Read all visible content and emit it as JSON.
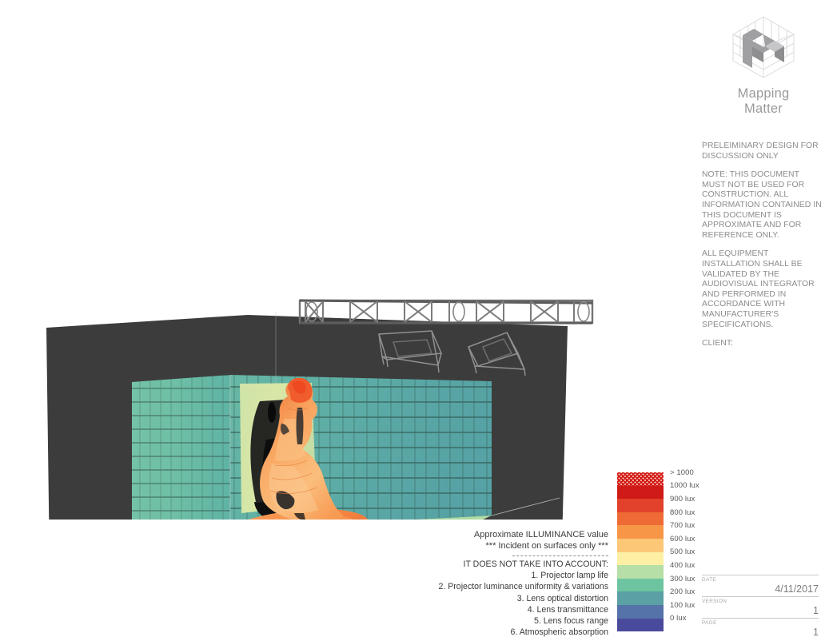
{
  "brand": {
    "name_line1": "Mapping",
    "name_line2": "Matter",
    "logo_icon": "isometric-cube-m-logo"
  },
  "disclaimer": {
    "leading_dot": ".",
    "p1": "PRELEIMINARY DESIGN FOR DISCUSSION ONLY",
    "p2": "NOTE: THIS DOCUMENT MUST NOT BE USED FOR CONSTRUCTION. ALL INFORMATION CONTAINED IN THIS DOCUMENT IS APPROXIMATE AND FOR REFERENCE ONLY.",
    "p3": "ALL EQUIPMENT INSTALLATION SHALL BE VALIDATED BY THE AUDIOVISUAL INTEGRATOR AND PERFORMED IN ACCORDANCE WITH MANUFACTURER'S SPECIFICATIONS.",
    "p4": "CLIENT:"
  },
  "title_block": {
    "date_key": "DATE",
    "date_value": "4/11/2017",
    "version_key": "VERSION",
    "version_value": "1",
    "page_key": "PAGE",
    "page_value": "1"
  },
  "notes": {
    "line1": "Approximate ILLUMINANCE value",
    "line2": "*** Incident on surfaces only ***",
    "heading": "IT DOES NOT TAKE INTO ACCOUNT:",
    "items": [
      "1. Projector lamp life",
      "2. Projector luminance uniformity & variations",
      "3. Lens optical distortion",
      "4. Lens transmittance",
      "5. Lens focus range",
      "6. Atmospheric absorption"
    ]
  },
  "chart_data": {
    "type": "heatmap",
    "title": "Approximate ILLUMINANCE value",
    "unit": "lux",
    "scale_name": "illuminance-color-scale",
    "legend_position": "bottom-right",
    "legend": [
      {
        "label": "> 1000",
        "value": 1100,
        "color": "#d21b16",
        "pattern": "stipple"
      },
      {
        "label": "1000 lux",
        "value": 1000,
        "color": "#cf1a18",
        "pattern": "solid"
      },
      {
        "label": "900 lux",
        "value": 900,
        "color": "#e2412c",
        "pattern": "solid"
      },
      {
        "label": "800 lux",
        "value": 800,
        "color": "#ef6b36",
        "pattern": "solid"
      },
      {
        "label": "700 lux",
        "value": 700,
        "color": "#f89648",
        "pattern": "solid"
      },
      {
        "label": "600 lux",
        "value": 600,
        "color": "#fcc877",
        "pattern": "solid"
      },
      {
        "label": "500 lux",
        "value": 500,
        "color": "#fdf0a4",
        "pattern": "solid"
      },
      {
        "label": "400 lux",
        "value": 400,
        "color": "#b5dfa6",
        "pattern": "solid"
      },
      {
        "label": "300 lux",
        "value": 300,
        "color": "#6cc5a0",
        "pattern": "solid"
      },
      {
        "label": "200 lux",
        "value": 200,
        "color": "#5aa0a4",
        "pattern": "solid"
      },
      {
        "label": "100 lux",
        "value": 100,
        "color": "#5573a8",
        "pattern": "solid"
      },
      {
        "label": "0 lux",
        "value": 0,
        "color": "#4a4a9c",
        "pattern": "solid"
      }
    ],
    "scene": {
      "description": "Perspective 3D render of a seated statue in a corner room with projection-mapped illuminance falloff",
      "background_color": "#3a3a3a",
      "subject_peak_color": "#f3733b",
      "wall_base_color": "#6cbfa5",
      "truss_color": "#6f6f71",
      "projector_count": 2
    }
  }
}
